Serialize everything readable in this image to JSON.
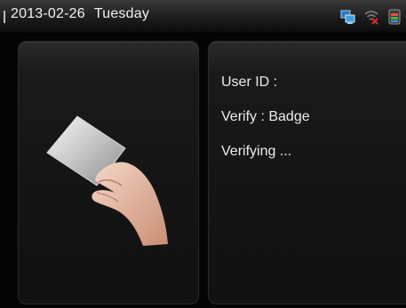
{
  "status_bar": {
    "date": "2013-02-26",
    "weekday": "Tuesday",
    "icons": [
      "network-icon",
      "wifi-disconnected-icon",
      "battery-icon"
    ]
  },
  "verify_panel": {
    "user_id_label": "User ID :",
    "verify_label": "Verify : Badge",
    "status": "Verifying ..."
  },
  "illustration": {
    "icon": "hand-holding-card-icon"
  },
  "colors": {
    "background": "#050505",
    "panel": "#151515",
    "text": "#ececec",
    "alert": "#d8281e",
    "accent_blue": "#3aa0e0"
  }
}
